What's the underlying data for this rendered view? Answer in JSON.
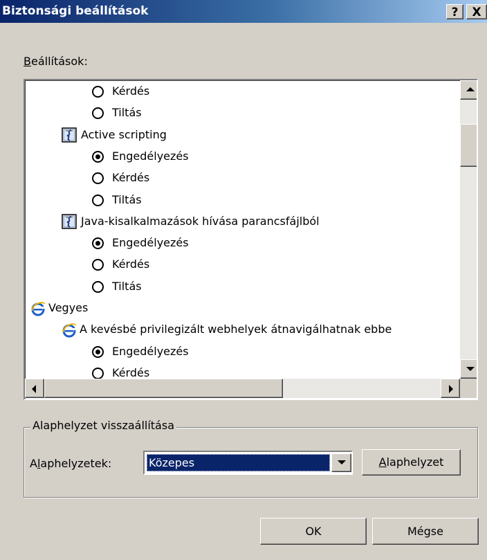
{
  "window": {
    "title": "Biztonsági beállítások",
    "help_glyph": "?",
    "close_glyph": "X"
  },
  "settings_label": {
    "first": "B",
    "rest": "eállítások:"
  },
  "list_items": [
    {
      "kind": "radio",
      "checked": false,
      "label": "Kérdés"
    },
    {
      "kind": "radio",
      "checked": false,
      "label": "Tiltás"
    },
    {
      "kind": "setting",
      "icon": "script-icon",
      "label": "Active scripting"
    },
    {
      "kind": "radio",
      "checked": true,
      "label": "Engedélyezés"
    },
    {
      "kind": "radio",
      "checked": false,
      "label": "Kérdés"
    },
    {
      "kind": "radio",
      "checked": false,
      "label": "Tiltás"
    },
    {
      "kind": "setting",
      "icon": "script-icon",
      "label": "Java-kisalkalmazások hívása parancsfájlból"
    },
    {
      "kind": "radio",
      "checked": true,
      "label": "Engedélyezés"
    },
    {
      "kind": "radio",
      "checked": false,
      "label": "Kérdés"
    },
    {
      "kind": "radio",
      "checked": false,
      "label": "Tiltás"
    },
    {
      "kind": "category",
      "icon": "ie-icon",
      "label": "Vegyes"
    },
    {
      "kind": "setting",
      "icon": "ie-icon",
      "label": "A kevésbé privilegizált webhelyek átnavigálhatnak ebbe"
    },
    {
      "kind": "radio",
      "checked": true,
      "label": "Engedélyezés"
    },
    {
      "kind": "radio",
      "checked": false,
      "label": "Kérdés"
    }
  ],
  "reset_group": {
    "legend": "Alaphelyzet visszaállítása",
    "preset_label_a": "A",
    "preset_label_l": "l",
    "preset_label_rest": "aphelyzetek:",
    "preset_value": "Közepes",
    "reset_button_first": "A",
    "reset_button_rest": "laphelyzet"
  },
  "buttons": {
    "ok": "OK",
    "cancel": "Mégse"
  },
  "colors": {
    "titlebar_start": "#0a246a",
    "titlebar_end": "#a6caf0",
    "face": "#d4d0c8",
    "selection": "#0a246a"
  }
}
